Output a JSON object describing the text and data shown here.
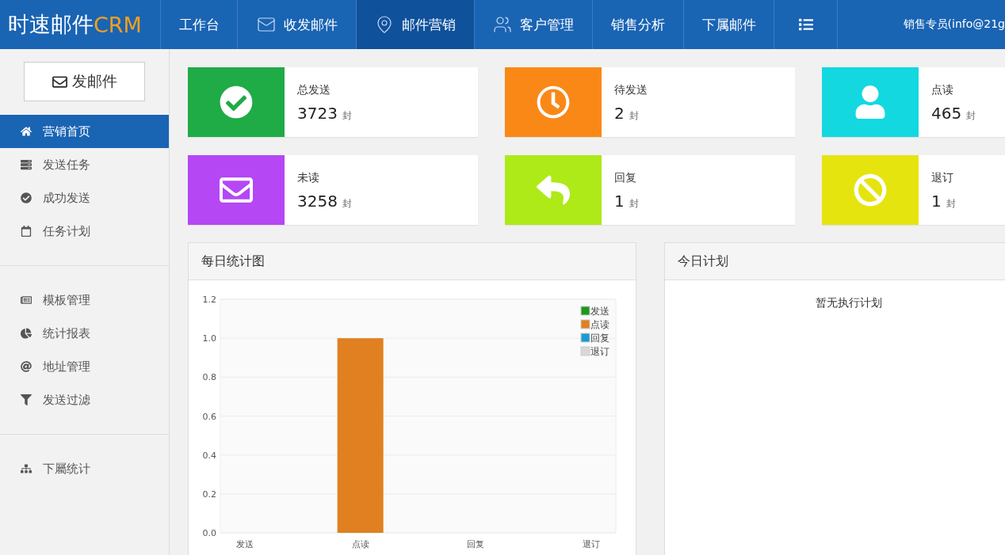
{
  "header": {
    "logo": {
      "main": "时速邮件",
      "accent": "CRM"
    },
    "nav": [
      {
        "label": "工作台",
        "selected": false
      },
      {
        "label": "收发邮件",
        "selected": false
      },
      {
        "label": "邮件营销",
        "selected": true
      },
      {
        "label": "客户管理",
        "selected": false
      },
      {
        "label": "销售分析",
        "selected": false
      },
      {
        "label": "下属邮件",
        "selected": false
      }
    ],
    "user": "销售专员(info@21g"
  },
  "sidebar": {
    "compose_button": "发邮件",
    "groups": [
      [
        {
          "label": "营销首页",
          "selected": true
        },
        {
          "label": "发送任务",
          "selected": false
        },
        {
          "label": "成功发送",
          "selected": false
        },
        {
          "label": "任务计划",
          "selected": false
        }
      ],
      [
        {
          "label": "模板管理",
          "selected": false
        },
        {
          "label": "统计报表",
          "selected": false
        },
        {
          "label": "地址管理",
          "selected": false
        },
        {
          "label": "发送过滤",
          "selected": false
        }
      ],
      [
        {
          "label": "下屬统计",
          "selected": false
        }
      ]
    ]
  },
  "stats": [
    {
      "label": "总发送",
      "value": "3723",
      "unit": "封",
      "color": "#1fab46"
    },
    {
      "label": "待发送",
      "value": "2",
      "unit": "封",
      "color": "#fa8817"
    },
    {
      "label": "点读",
      "value": "465",
      "unit": "封",
      "color": "#13d8e0"
    },
    {
      "label": "未读",
      "value": "3258",
      "unit": "封",
      "color": "#b547f5"
    },
    {
      "label": "回复",
      "value": "1",
      "unit": "封",
      "color": "#aee918"
    },
    {
      "label": "退订",
      "value": "1",
      "unit": "封",
      "color": "#e6e40f"
    }
  ],
  "chart_panel": {
    "title": "每日统计图",
    "chart_data": {
      "type": "bar",
      "categories": [
        "发送",
        "点读",
        "回复",
        "退订"
      ],
      "series": [
        {
          "name": "发送",
          "color": "#1a9a1a",
          "values": [
            0,
            null,
            null,
            null
          ]
        },
        {
          "name": "点读",
          "color": "#e08020",
          "values": [
            null,
            1,
            null,
            null
          ]
        },
        {
          "name": "回复",
          "color": "#1a9ad6",
          "values": [
            null,
            null,
            0,
            null
          ]
        },
        {
          "name": "退订",
          "color": "#d8d8d8",
          "values": [
            null,
            null,
            null,
            0
          ]
        }
      ],
      "ylim": [
        0,
        1.2
      ],
      "grid": true,
      "yticks": [
        {
          "value": 0,
          "label": "0.0"
        },
        {
          "value": 0.2,
          "label": "0.2"
        },
        {
          "value": 0.4,
          "label": "0.4"
        },
        {
          "value": 0.6,
          "label": "0.6"
        },
        {
          "value": 0.8,
          "label": "0.8"
        },
        {
          "value": 1,
          "label": "1.0"
        },
        {
          "value": 1.2,
          "label": "1.2"
        }
      ]
    }
  },
  "plan_panel": {
    "title": "今日计划",
    "message": "暂无执行计划"
  }
}
